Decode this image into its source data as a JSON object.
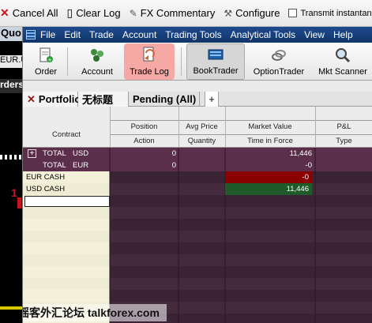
{
  "bg_toolbar": {
    "cancel_all": "Cancel All",
    "clear_log": "Clear Log",
    "fx_commentary": "FX Commentary",
    "configure": "Configure",
    "transmit": "Transmit instantaneously"
  },
  "bg_left": {
    "quotes": "Quo",
    "eurusd": "EUR.USD",
    "orders": "rders",
    "price": "1"
  },
  "menu": [
    "File",
    "Edit",
    "Trade",
    "Account",
    "Trading Tools",
    "Analytical Tools",
    "View",
    "Help"
  ],
  "toolbar": {
    "order": "Order",
    "account": "Account",
    "trade_log": "Trade Log",
    "booktrader": "BookTrader",
    "optiontrader": "OptionTrader",
    "mkt_scanner": "Mkt Scanner"
  },
  "tabs": {
    "portfolio": "Portfolio",
    "untitled": "无标题",
    "pending": "Pending (All)",
    "add": "+"
  },
  "columns": {
    "contract": "Contract",
    "position": "Position",
    "action": "Action",
    "avg_price": "Avg Price",
    "quantity": "Quantity",
    "market_value": "Market Value",
    "time_in_force": "Time in Force",
    "pl": "P&L",
    "type": "Type"
  },
  "rows": [
    {
      "expand": "+",
      "label": "TOTAL",
      "ccy": "USD",
      "position": "0",
      "market_value": "11,446"
    },
    {
      "label": "TOTAL",
      "ccy": "EUR",
      "position": "0",
      "market_value": "-0"
    },
    {
      "contract": "EUR CASH",
      "market_value": "-0"
    },
    {
      "contract": "USD CASH",
      "market_value": "11,446"
    }
  ],
  "watermark": "摇客外汇论坛 talkforex.com",
  "colors": {
    "title_bar": "#123569",
    "grid_bg": "#3c2435",
    "contract_col": "#f3f1d9",
    "negative": "#8b0000",
    "positive": "#1f5a2a",
    "active_tool": "#f5a8a4"
  }
}
